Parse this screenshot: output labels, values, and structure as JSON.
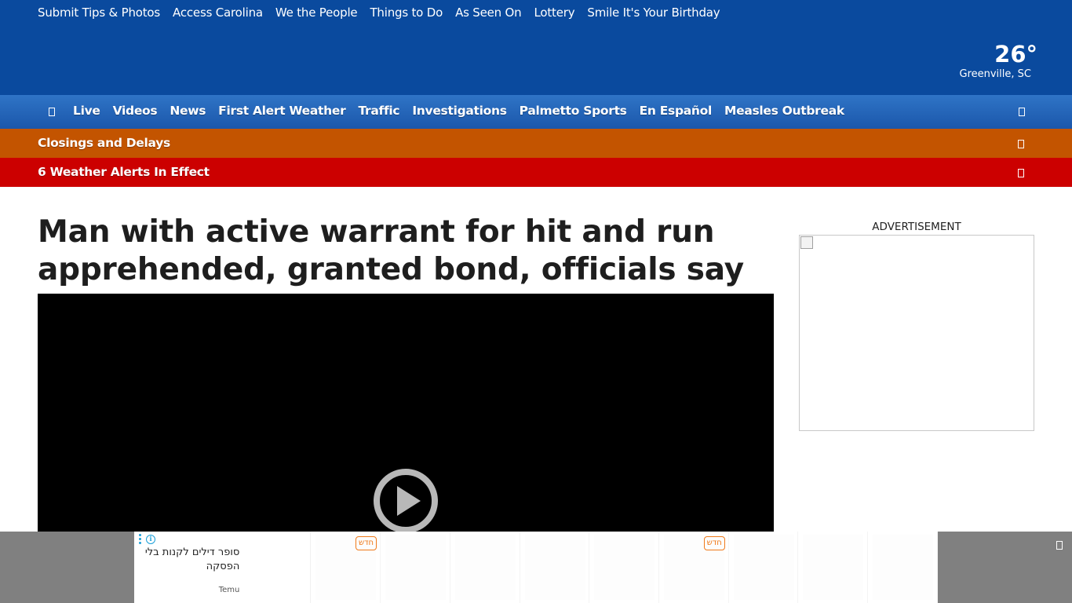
{
  "utility_nav": {
    "links": [
      "Submit Tips & Photos",
      "Access Carolina",
      "We the People",
      "Things to Do",
      "As Seen On",
      "Lottery",
      "Smile It's Your Birthday"
    ]
  },
  "weather": {
    "temperature": "26°",
    "location": "Greenville, SC"
  },
  "main_nav": {
    "menu_icon": "menu-icon",
    "search_icon": "search-icon",
    "items": [
      "Live",
      "Videos",
      "News",
      "First Alert Weather",
      "Traffic",
      "Investigations",
      "Palmetto Sports",
      "En Español",
      "Measles Outbreak"
    ]
  },
  "alerts": {
    "closings_label": "Closings and Delays",
    "weather_label": "6 Weather Alerts In Effect"
  },
  "article": {
    "headline": "Man with active warrant for hit and run apprehended, granted bond, officials say"
  },
  "sidebar": {
    "ad_label": "ADVERTISEMENT"
  },
  "sticky_ad": {
    "headline": "סופר דילים לקנות בלי הפסקה",
    "brand": "Temu",
    "badge": "חדש",
    "tiles": [
      {
        "badge": "חדש"
      },
      {
        "badge": ""
      },
      {
        "badge": ""
      },
      {
        "badge": ""
      },
      {
        "badge": ""
      },
      {
        "badge": "חדש"
      },
      {
        "badge": ""
      },
      {
        "badge": ""
      },
      {
        "badge": ""
      }
    ]
  },
  "colors": {
    "header_blue": "#0a4a9e",
    "nav_blue": "#1b57ab",
    "closings_orange": "#c35400",
    "alert_red": "#cc0000",
    "badge_orange": "#f07a1a"
  }
}
